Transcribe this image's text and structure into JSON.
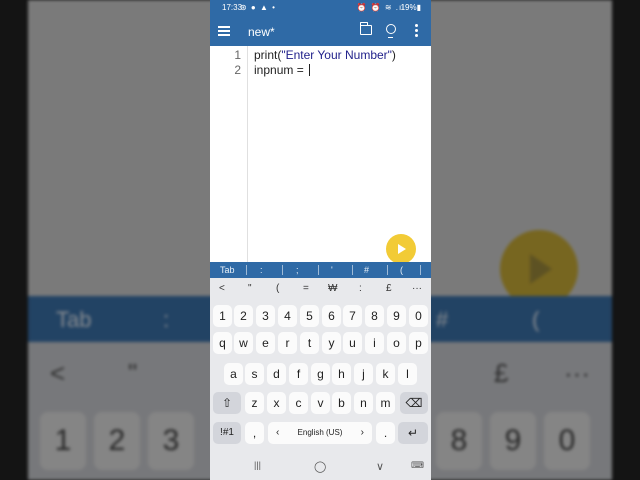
{
  "background_mirror": {
    "bar_items": [
      "Tab",
      ":",
      "#",
      "("
    ],
    "symbols": [
      "<",
      "\"",
      "£",
      "···"
    ],
    "keys": [
      "1",
      "2",
      "3",
      "8",
      "9",
      "0"
    ]
  },
  "status": {
    "time": "17:33",
    "left_icons": "⊛ ● ▲ •",
    "right_icons": "⏰ ⏰ ≋ .ıl",
    "battery": "19%▮"
  },
  "app": {
    "title": "new*"
  },
  "editor": {
    "lines": [
      {
        "num": "1",
        "prefix": "print(",
        "string": "\"Enter Your Number\"",
        "suffix": ")"
      },
      {
        "num": "2",
        "prefix": "inpnum = ",
        "string": "",
        "suffix": ""
      }
    ]
  },
  "symbol_bar": [
    "Tab",
    ":",
    ";",
    "'",
    "#",
    "("
  ],
  "keyboard": {
    "suggestions": [
      "<",
      "\"",
      "(",
      "=",
      "₩",
      ":",
      "£",
      "···"
    ],
    "row1": [
      "1",
      "2",
      "3",
      "4",
      "5",
      "6",
      "7",
      "8",
      "9",
      "0"
    ],
    "row2": [
      "q",
      "w",
      "e",
      "r",
      "t",
      "y",
      "u",
      "i",
      "o",
      "p"
    ],
    "row3": [
      "a",
      "s",
      "d",
      "f",
      "g",
      "h",
      "j",
      "k",
      "l"
    ],
    "row4": [
      "z",
      "x",
      "c",
      "v",
      "b",
      "n",
      "m"
    ],
    "symbols_key": "!#1",
    "comma": ",",
    "space_left": "‹",
    "space_label": "English (US)",
    "space_right": "›",
    "period": ".",
    "shift": "⇧",
    "backspace": "⌫",
    "enter": "↵"
  },
  "nav": {
    "recents": "|||",
    "home": "◯",
    "back": "∨",
    "keyboard": "⌨"
  },
  "colors": {
    "primary": "#2f6aa6",
    "fab": "#f2cb36",
    "string": "#1f1f8a"
  }
}
